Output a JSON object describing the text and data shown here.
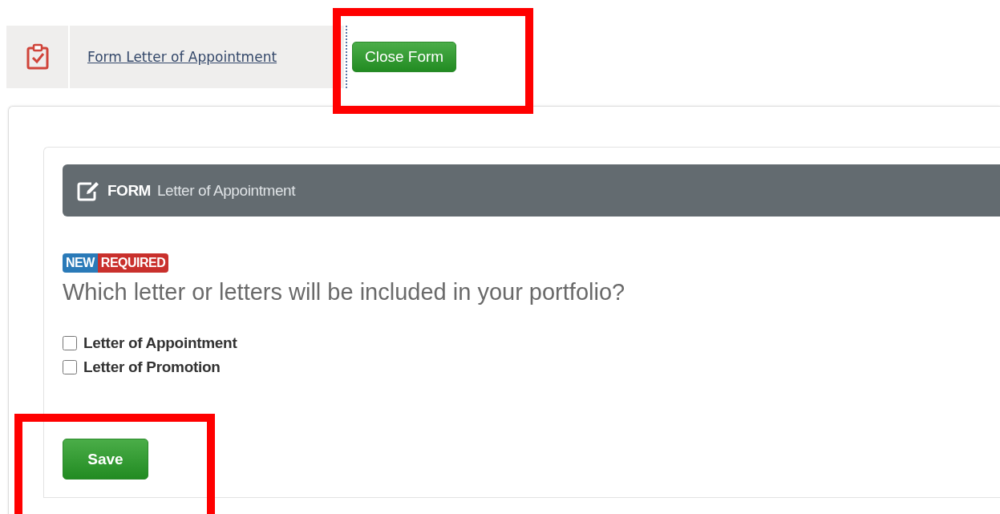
{
  "breadcrumb": {
    "link": "Form Letter of Appointment"
  },
  "close_button": {
    "label": "Close Form"
  },
  "form": {
    "heading": "FORM",
    "title": "Letter of Appointment",
    "badges": [
      {
        "label": "NEW",
        "color": "#2a7ab8"
      },
      {
        "label": "REQUIRED",
        "color": "#c9302c"
      }
    ],
    "question": "Which letter or letters will be included in your portfolio?",
    "options": [
      {
        "label": "Letter of Appointment",
        "checked": false
      },
      {
        "label": "Letter of Promotion",
        "checked": false
      }
    ],
    "save_button": {
      "label": "Save"
    }
  }
}
